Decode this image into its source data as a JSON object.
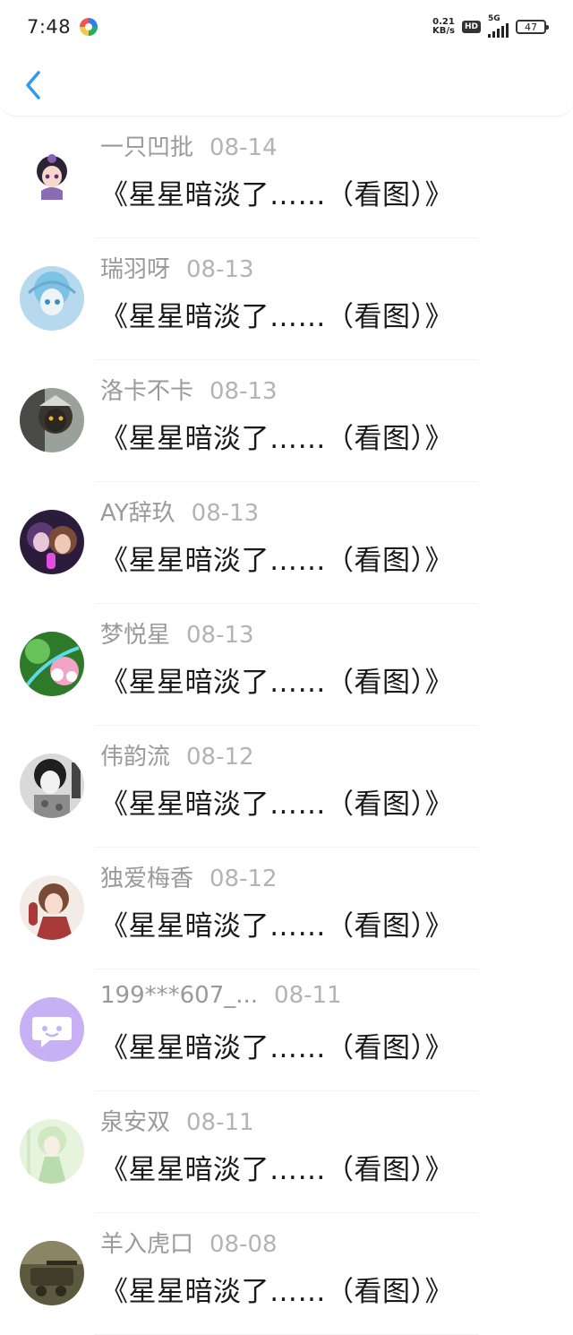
{
  "status_bar": {
    "time": "7:48",
    "net_speed_value": "0.21",
    "net_speed_unit": "KB/s",
    "hd": "HD",
    "network": "5G",
    "battery": "47"
  },
  "nav": {
    "back_icon": "chevron-left-icon",
    "accent_color": "#2f9bf0"
  },
  "items": [
    {
      "name": "一只凹批",
      "date": "08-14",
      "title": "《星星暗淡了……（看图）》",
      "avatar": "anime-girl-chibi"
    },
    {
      "name": "瑞羽呀",
      "date": "08-13",
      "title": "《星星暗淡了……（看图）》",
      "avatar": "anime-blue-hair"
    },
    {
      "name": "洛卡不卡",
      "date": "08-13",
      "title": "《星星暗淡了……（看图）》",
      "avatar": "anime-masked"
    },
    {
      "name": "AY辞玖",
      "date": "08-13",
      "title": "《星星暗淡了……（看图）》",
      "avatar": "anime-purple-pair"
    },
    {
      "name": "梦悦星",
      "date": "08-13",
      "title": "《星星暗淡了……（看图）》",
      "avatar": "anime-green-flower"
    },
    {
      "name": "伟韵流",
      "date": "08-12",
      "title": "《星星暗淡了……（看图）》",
      "avatar": "grayscale-anime-boy"
    },
    {
      "name": "独爱梅香",
      "date": "08-12",
      "title": "《星星暗淡了……（看图）》",
      "avatar": "anime-red-girl"
    },
    {
      "name": "199***607_...",
      "date": "08-11",
      "title": "《星星暗淡了……（看图）》",
      "avatar": "default-chat-icon"
    },
    {
      "name": "泉安双",
      "date": "08-11",
      "title": "《星星暗淡了……（看图）》",
      "avatar": "anime-pale-green"
    },
    {
      "name": "羊入虎口",
      "date": "08-08",
      "title": "《星星暗淡了……（看图）》",
      "avatar": "tank-photo"
    }
  ]
}
